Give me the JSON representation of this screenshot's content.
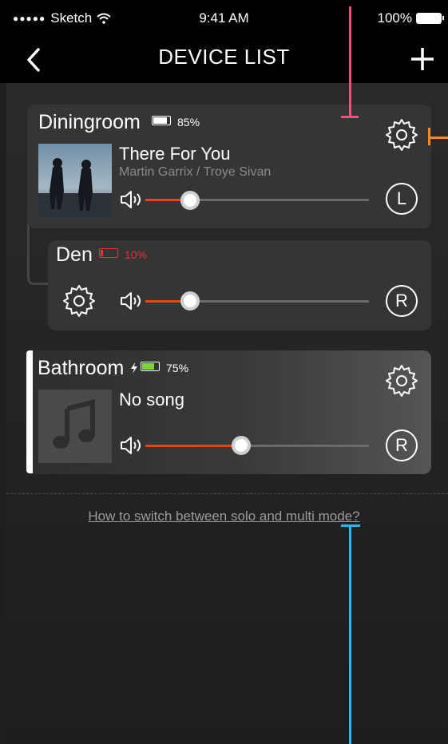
{
  "status_bar": {
    "carrier": "Sketch",
    "time": "9:41 AM",
    "battery": "100%"
  },
  "nav": {
    "title": "DEVICE LIST",
    "back_icon": "chevron-left-icon",
    "add_icon": "plus-icon"
  },
  "devices": [
    {
      "name": "Diningroom",
      "battery_pct": "85%",
      "battery_level": 0.85,
      "song_title": "There For You",
      "song_artist": "Martin Garrix / Troye Sivan",
      "volume": 0.2,
      "channel": "L"
    },
    {
      "name": "Den",
      "battery_pct": "10%",
      "battery_level": 0.1,
      "volume": 0.2,
      "channel": "R"
    },
    {
      "name": "Bathroom",
      "battery_pct": "75%",
      "battery_level": 0.75,
      "charging": true,
      "song_title": "No song",
      "volume": 0.43,
      "channel": "R"
    }
  ],
  "help_link": "How to switch between solo and multi mode?",
  "colors": {
    "accent": "#e0461a",
    "battery_low": "#e0343a",
    "battery_charging": "#7ed23b",
    "annotation_pink": "#e5557f",
    "annotation_orange": "#f28b2b",
    "annotation_blue": "#2bb8f0"
  }
}
